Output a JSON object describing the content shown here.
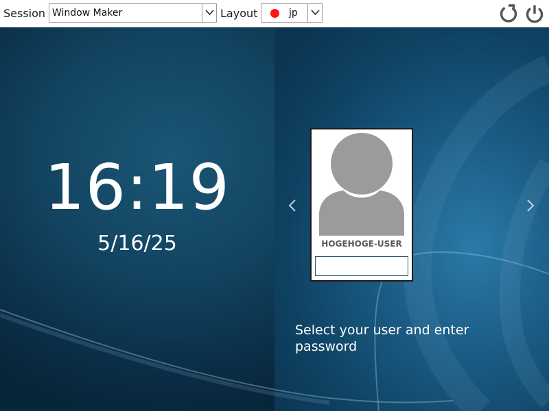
{
  "topbar": {
    "session_label": "Session",
    "session_value": "Window Maker",
    "layout_label": "Layout",
    "layout_value": "jp",
    "layout_indicator_color": "#ff1515"
  },
  "actions": {
    "restart_icon": "restart-icon",
    "power_icon": "power-icon"
  },
  "clock": {
    "time": "16:19",
    "date": "5/16/25"
  },
  "greeter": {
    "username": "HOGEHOGE-USER",
    "password_value": "",
    "prompt": "Select your user and enter password"
  },
  "colors": {
    "background": "#0d3550",
    "accent": "#1f6f9c",
    "avatar_gray": "#9b9b9b"
  }
}
